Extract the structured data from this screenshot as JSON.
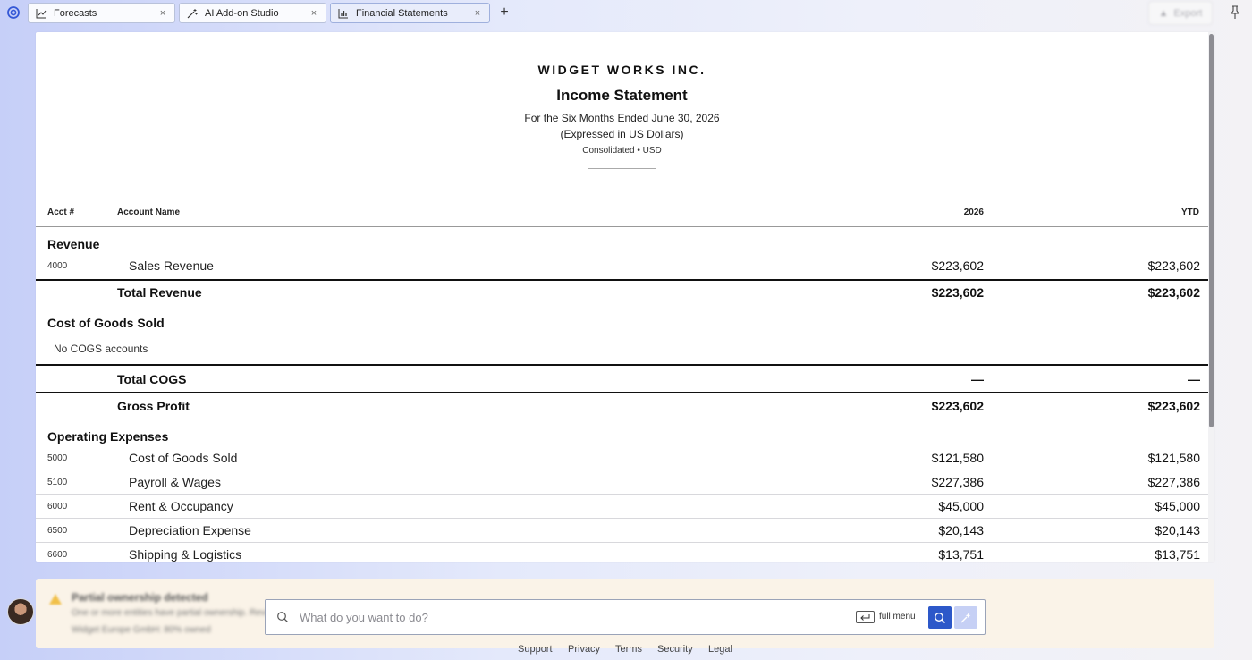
{
  "tabs": [
    {
      "label": "Forecasts",
      "icon": "line-chart-icon"
    },
    {
      "label": "AI Add-on Studio",
      "icon": "magic-wand-icon"
    },
    {
      "label": "Financial Statements",
      "icon": "bar-chart-icon",
      "active": true
    }
  ],
  "new_tab_label": "+",
  "close_glyph": "×",
  "export_label": "Export",
  "report": {
    "company": "WIDGET WORKS INC.",
    "title": "Income Statement",
    "period": "For the Six Months Ended June 30, 2026",
    "currency_note": "(Expressed in US Dollars)",
    "scope": "Consolidated • USD",
    "columns": {
      "acct": "Acct #",
      "name": "Account Name",
      "y2026": "2026",
      "ytd": "YTD"
    },
    "revenue": {
      "title": "Revenue",
      "rows": [
        {
          "acct": "4000",
          "name": "Sales Revenue",
          "y2026": "$223,602",
          "ytd": "$223,602"
        }
      ],
      "total_label": "Total Revenue",
      "total_2026": "$223,602",
      "total_ytd": "$223,602"
    },
    "cogs": {
      "title": "Cost of Goods Sold",
      "empty_note": "No COGS accounts",
      "total_label": "Total COGS",
      "total_2026": "—",
      "total_ytd": "—"
    },
    "gross_profit": {
      "label": "Gross Profit",
      "y2026": "$223,602",
      "ytd": "$223,602"
    },
    "opex": {
      "title": "Operating Expenses",
      "rows": [
        {
          "acct": "5000",
          "name": "Cost of Goods Sold",
          "y2026": "$121,580",
          "ytd": "$121,580"
        },
        {
          "acct": "5100",
          "name": "Payroll & Wages",
          "y2026": "$227,386",
          "ytd": "$227,386"
        },
        {
          "acct": "6000",
          "name": "Rent & Occupancy",
          "y2026": "$45,000",
          "ytd": "$45,000"
        },
        {
          "acct": "6500",
          "name": "Depreciation Expense",
          "y2026": "$20,143",
          "ytd": "$20,143"
        },
        {
          "acct": "6600",
          "name": "Shipping & Logistics",
          "y2026": "$13,751",
          "ytd": "$13,751"
        }
      ]
    }
  },
  "notice": {
    "title": "Partial ownership detected",
    "body": "One or more entities have partial ownership. Review",
    "sub": "Widget Europe GmbH: 80% owned"
  },
  "command_bar": {
    "placeholder": "What do you want to do?",
    "enter_hint": "full menu"
  },
  "footer": [
    "Support",
    "Privacy",
    "Terms",
    "Security",
    "Legal"
  ],
  "colors": {
    "accent": "#2d58c9",
    "ai_button": "#c6d0f5",
    "notice_bg": "#faf3e8"
  }
}
